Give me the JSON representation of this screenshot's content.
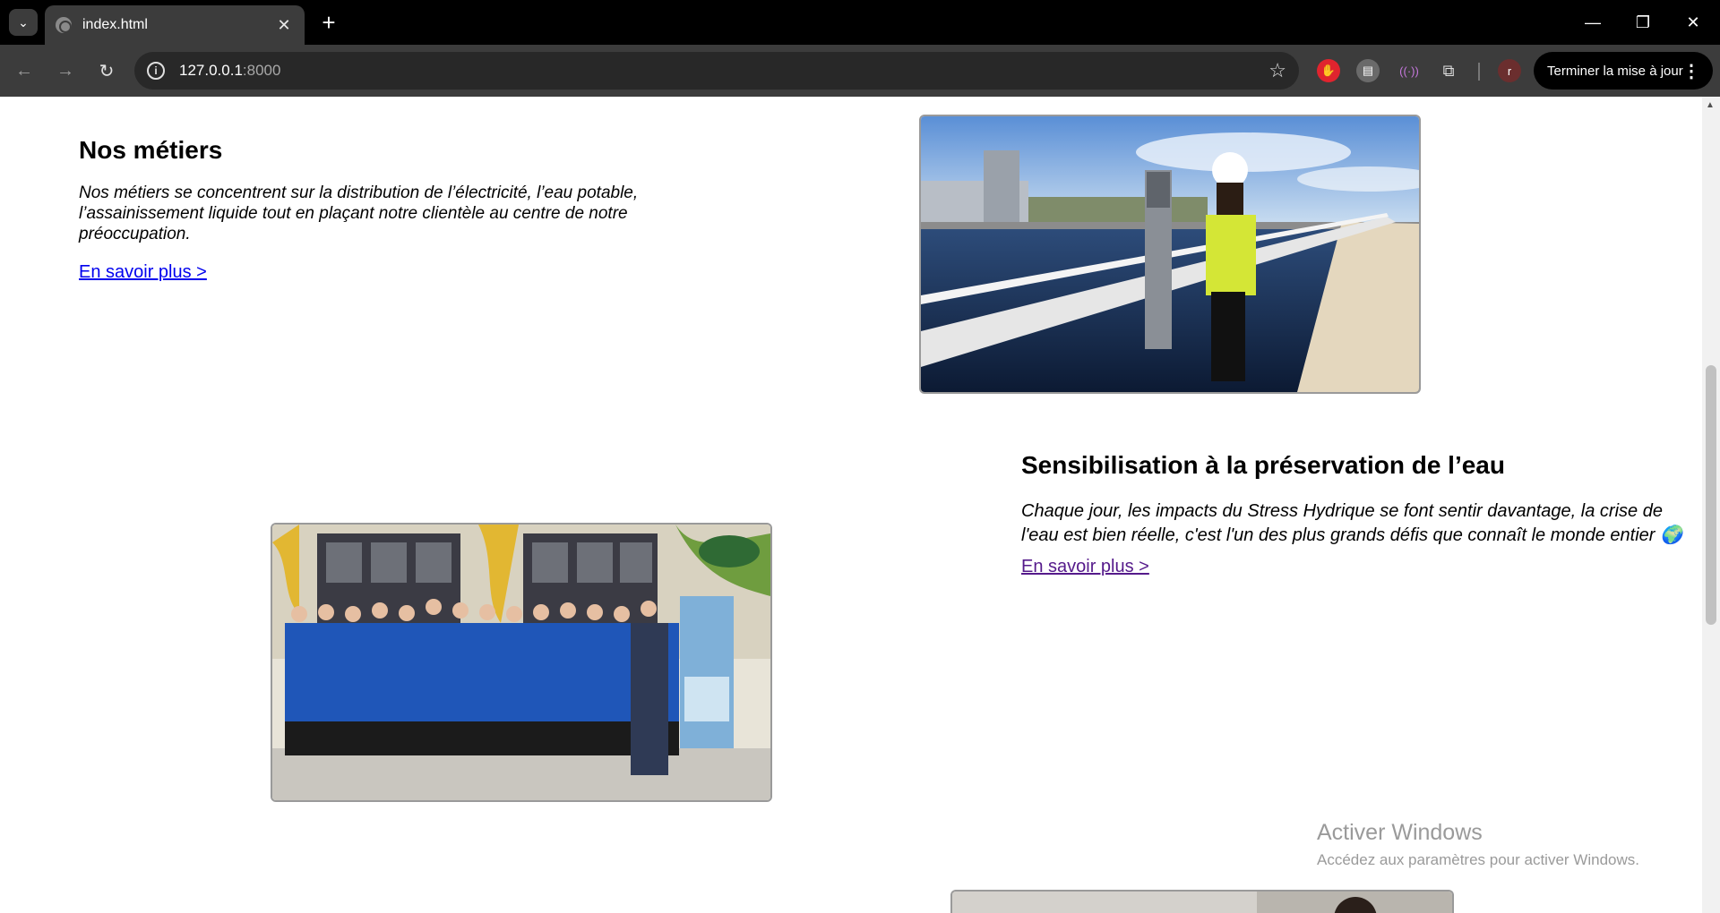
{
  "browser": {
    "tab_title": "index.html",
    "url_host": "127.0.0.1",
    "url_port": ":8000",
    "update_button": "Terminer la mise à jour",
    "profile_initial": "r"
  },
  "sections": [
    {
      "title": "Nos métiers",
      "text": "Nos métiers se concentrent sur la distribution de l’électricité, l’eau potable, l’assainissement liquide tout en plaçant notre clientèle au centre de notre préoccupation.",
      "link": "En savoir plus >"
    },
    {
      "title": "Sensibilisation à la préservation de l’eau",
      "text": "Chaque jour, les impacts du Stress Hydrique se font sentir davantage, la crise de l'eau est bien réelle, c'est l'un des plus grands défis que connaît le monde entier 🌍",
      "link": "En savoir plus >"
    }
  ],
  "watermark": {
    "line1": "Activer Windows",
    "line2": "Accédez aux paramètres pour activer Windows."
  },
  "icons": {
    "back": "arrow-left-icon",
    "forward": "arrow-right-icon",
    "reload": "reload-icon",
    "info": "info-icon",
    "bookmark": "star-icon",
    "extensions": "puzzle-icon",
    "menu": "kebab-icon"
  },
  "colors": {
    "link": "#0000ee",
    "visited_link": "#551a8b",
    "chrome_dark": "#3c3c3c"
  }
}
